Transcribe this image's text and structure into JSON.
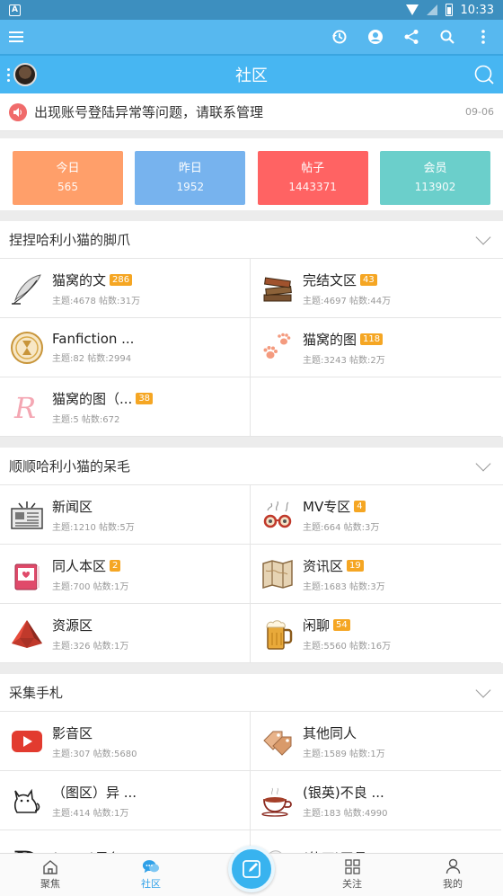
{
  "statusbar": {
    "left_glyph": "A",
    "time": "10:33"
  },
  "toolbar": {
    "icons": [
      "menu-icon",
      "history-icon",
      "account-icon",
      "share-icon",
      "search-icon",
      "more-icon"
    ]
  },
  "header": {
    "title": "社区"
  },
  "notice": {
    "text": "出现账号登陆异常等问题，请联系管理",
    "time": "09-06"
  },
  "stats": [
    {
      "label": "今日",
      "value": "565",
      "color": "#ff9f6a"
    },
    {
      "label": "昨日",
      "value": "1952",
      "color": "#77b3ee"
    },
    {
      "label": "帖子",
      "value": "1443371",
      "color": "#ff6363"
    },
    {
      "label": "会员",
      "value": "113902",
      "color": "#6bcfcb"
    }
  ],
  "sections": [
    {
      "title": "捏捏哈利小猫的脚爪",
      "forums": [
        {
          "name": "猫窝的文",
          "badge": "286",
          "meta": "主题:4678 帖数:31万",
          "icon": "quill-icon"
        },
        {
          "name": "完结文区",
          "badge": "43",
          "meta": "主题:4697 帖数:44万",
          "icon": "books-icon"
        },
        {
          "name": "Fanfiction ...",
          "badge": "",
          "meta": "主题:82 帖数:2994",
          "icon": "hourglass-icon"
        },
        {
          "name": "猫窝的图",
          "badge": "118",
          "meta": "主题:3243 帖数:2万",
          "icon": "paw-icon"
        },
        {
          "name": "猫窝的图（...",
          "badge": "38",
          "meta": "主题:5 帖数:672",
          "icon": "letter-r-icon"
        }
      ]
    },
    {
      "title": "顺顺哈利小猫的呆毛",
      "forums": [
        {
          "name": "新闻区",
          "badge": "",
          "meta": "主题:1210 帖数:5万",
          "icon": "newspaper-icon"
        },
        {
          "name": "MV专区",
          "badge": "4",
          "meta": "主题:664 帖数:3万",
          "icon": "glasses-icon"
        },
        {
          "name": "同人本区",
          "badge": "2",
          "meta": "主题:700 帖数:1万",
          "icon": "book-heart-icon"
        },
        {
          "name": "资讯区",
          "badge": "19",
          "meta": "主题:1683 帖数:3万",
          "icon": "map-icon"
        },
        {
          "name": "资源区",
          "badge": "",
          "meta": "主题:326 帖数:1万",
          "icon": "crystal-icon"
        },
        {
          "name": "闲聊",
          "badge": "54",
          "meta": "主题:5560 帖数:16万",
          "icon": "beer-icon"
        }
      ]
    },
    {
      "title": "采集手札",
      "forums": [
        {
          "name": "影音区",
          "badge": "",
          "meta": "主题:307 帖数:5680",
          "icon": "play-icon"
        },
        {
          "name": "其他同人",
          "badge": "",
          "meta": "主题:1589 帖数:1万",
          "icon": "tags-icon"
        },
        {
          "name": "（图区）异 ...",
          "badge": "",
          "meta": "主题:414 帖数:1万",
          "icon": "cat-icon"
        },
        {
          "name": "(银英)不良 ...",
          "badge": "",
          "meta": "主题:183 帖数:4990",
          "icon": "teacup-icon"
        },
        {
          "name": "(DGM)黑色 ...",
          "badge": "",
          "meta": "",
          "icon": "letter-d-icon"
        },
        {
          "name": "(仙四)天悬 ...",
          "badge": "",
          "meta": "",
          "icon": "cloud-icon"
        }
      ]
    }
  ],
  "bottomnav": [
    {
      "label": "聚焦",
      "icon": "home-icon",
      "active": false
    },
    {
      "label": "社区",
      "icon": "chat-icon",
      "active": true
    },
    {
      "label": "",
      "icon": "compose-icon",
      "active": false
    },
    {
      "label": "关注",
      "icon": "grid-icon",
      "active": false
    },
    {
      "label": "我的",
      "icon": "person-icon",
      "active": false
    }
  ]
}
